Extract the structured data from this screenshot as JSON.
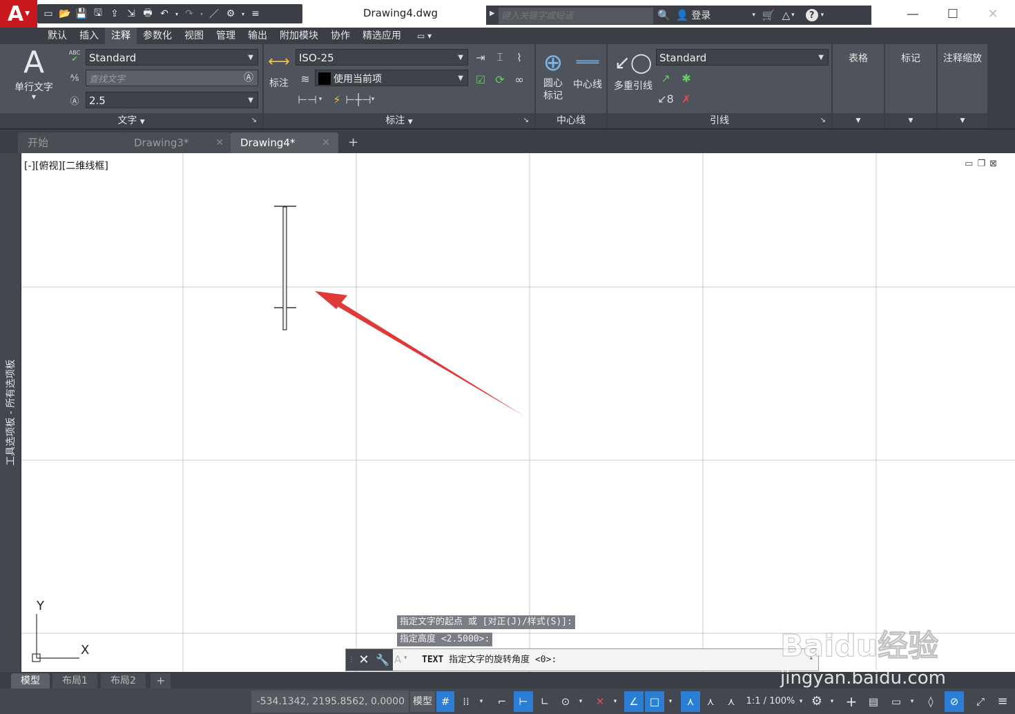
{
  "title_bar": {
    "logo": "A",
    "document_title": "Drawing4.dwg",
    "search_placeholder": "键入关键字或短语",
    "login_label": "登录",
    "help_label": "?"
  },
  "ribbon_tabs": [
    {
      "label": "默认"
    },
    {
      "label": "插入"
    },
    {
      "label": "注释",
      "active": true
    },
    {
      "label": "参数化"
    },
    {
      "label": "视图"
    },
    {
      "label": "管理"
    },
    {
      "label": "输出"
    },
    {
      "label": "附加模块"
    },
    {
      "label": "协作"
    },
    {
      "label": "精选应用"
    }
  ],
  "ribbon": {
    "text_panel": {
      "big_button_glyph": "A",
      "big_button_label": "单行文字",
      "abc_label": "ABC",
      "style_value": "Standard",
      "find_placeholder": "查找文字",
      "height_value": "2.5",
      "panel_title": "文字"
    },
    "dim_panel": {
      "big_button_label": "标注",
      "dimstyle_value": "ISO-25",
      "layer_value": "使用当前项",
      "panel_title": "标注"
    },
    "centerline_panel": {
      "center_mark_label_1": "圆心",
      "center_mark_label_2": "标记",
      "centerline_label": "中心线",
      "panel_title": "中心线"
    },
    "leader_panel": {
      "multileader_label": "多重引线",
      "style_value": "Standard",
      "panel_title": "引线"
    },
    "table_panel": {
      "label": "表格"
    },
    "markup_panel": {
      "label": "标记"
    },
    "scale_panel": {
      "label": "注释缩放"
    }
  },
  "doc_tabs": [
    {
      "label": "开始"
    },
    {
      "label": "Drawing3*"
    },
    {
      "label": "Drawing4*",
      "active": true
    },
    {
      "label": "+"
    }
  ],
  "left_palette_label": "工具选项板 - 所有选项板",
  "viewport_label": "[-][俯视][二维线框]",
  "ucs": {
    "x_label": "X",
    "y_label": "Y"
  },
  "command": {
    "history": [
      "指定文字的起点 或 [对正(J)/样式(S)]:",
      "指定高度 <2.5000>:"
    ],
    "command_name": "TEXT",
    "current_prompt": "指定文字的旋转角度 <0>:"
  },
  "layout_tabs": [
    {
      "label": "模型",
      "active": true
    },
    {
      "label": "布局1"
    },
    {
      "label": "布局2"
    },
    {
      "label": "+"
    }
  ],
  "status_bar": {
    "coordinates": "-534.1342, 2195.8562, 0.0000",
    "model_label": "模型",
    "scale_label": "1:1 / 100%"
  },
  "watermark": {
    "brand": "Baidu经验",
    "url": "jingyan.baidu.com"
  },
  "colors": {
    "accent_blue": "#2a7fd4",
    "logo_red": "#c8171d",
    "arrow_red": "#e0393a"
  }
}
